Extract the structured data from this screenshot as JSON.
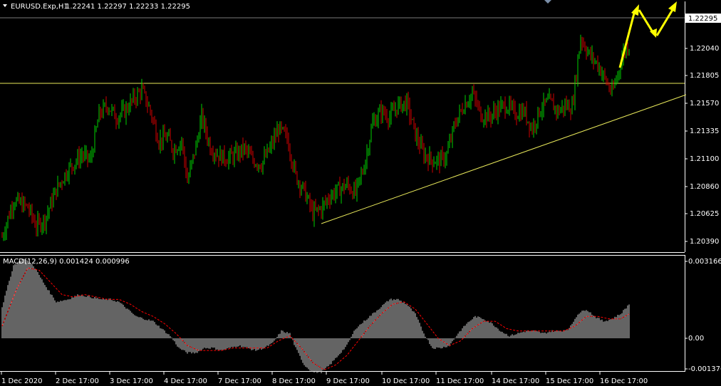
{
  "header": {
    "symbol_label": "EURUSD.Exp,H1",
    "ohlc_label": "1.22241 1.22297 1.22233 1.22295"
  },
  "macd_header": {
    "label": "MACD(12,26,9) 0.001424 0.000996"
  },
  "colors": {
    "background": "#000000",
    "bull": "#00d000",
    "bear": "#d00000",
    "line": "#e8e85a",
    "arrow": "#ffff00",
    "axis": "#ffffff",
    "macd_hist": "#c8c8c8",
    "macd_signal": "#ff0000"
  },
  "chart_data": [
    {
      "type": "candlestick",
      "title": "EURUSD.Exp,H1",
      "x_labels": [
        "1 Dec 2020",
        "2 Dec 17:00",
        "3 Dec 17:00",
        "4 Dec 17:00",
        "7 Dec 17:00",
        "8 Dec 17:00",
        "9 Dec 17:00",
        "10 Dec 17:00",
        "11 Dec 17:00",
        "14 Dec 17:00",
        "15 Dec 17:00",
        "16 Dec 17:00"
      ],
      "y_ticks": [
        "1.22295",
        "1.22040",
        "1.21805",
        "1.21570",
        "1.21335",
        "1.21100",
        "1.20860",
        "1.20625",
        "1.20390"
      ],
      "y_range": [
        1.2027,
        1.2263
      ],
      "current_price": 1.22295,
      "price_path": [
        [
          0,
          1.2043
        ],
        [
          8,
          1.2074
        ],
        [
          18,
          1.2068
        ],
        [
          24,
          1.2052
        ],
        [
          30,
          1.2058
        ],
        [
          38,
          1.2083
        ],
        [
          46,
          1.21
        ],
        [
          56,
          1.2113
        ],
        [
          62,
          1.2108
        ],
        [
          68,
          1.2147
        ],
        [
          74,
          1.2155
        ],
        [
          80,
          1.2145
        ],
        [
          86,
          1.215
        ],
        [
          92,
          1.216
        ],
        [
          98,
          1.2168
        ],
        [
          104,
          1.215
        ],
        [
          110,
          1.2125
        ],
        [
          116,
          1.2128
        ],
        [
          120,
          1.2117
        ],
        [
          126,
          1.2125
        ],
        [
          130,
          1.209
        ],
        [
          136,
          1.212
        ],
        [
          140,
          1.2145
        ],
        [
          146,
          1.212
        ],
        [
          152,
          1.2112
        ],
        [
          158,
          1.211
        ],
        [
          164,
          1.2113
        ],
        [
          170,
          1.2118
        ],
        [
          176,
          1.2108
        ],
        [
          182,
          1.2105
        ],
        [
          188,
          1.2118
        ],
        [
          194,
          1.2135
        ],
        [
          200,
          1.2127
        ],
        [
          206,
          1.2095
        ],
        [
          212,
          1.2082
        ],
        [
          218,
          1.2063
        ],
        [
          224,
          1.2067
        ],
        [
          230,
          1.2078
        ],
        [
          236,
          1.2083
        ],
        [
          242,
          1.2087
        ],
        [
          248,
          1.208
        ],
        [
          254,
          1.2103
        ],
        [
          260,
          1.214
        ],
        [
          266,
          1.215
        ],
        [
          272,
          1.2145
        ],
        [
          278,
          1.2155
        ],
        [
          284,
          1.2157
        ],
        [
          290,
          1.213
        ],
        [
          296,
          1.2113
        ],
        [
          302,
          1.2108
        ],
        [
          308,
          1.2108
        ],
        [
          312,
          1.2113
        ],
        [
          318,
          1.214
        ],
        [
          324,
          1.2155
        ],
        [
          330,
          1.2165
        ],
        [
          336,
          1.2147
        ],
        [
          342,
          1.2145
        ],
        [
          348,
          1.2152
        ],
        [
          354,
          1.2155
        ],
        [
          360,
          1.2148
        ],
        [
          366,
          1.215
        ],
        [
          372,
          1.2135
        ],
        [
          378,
          1.2153
        ],
        [
          384,
          1.2158
        ],
        [
          390,
          1.215
        ],
        [
          396,
          1.2155
        ],
        [
          400,
          1.2153
        ],
        [
          406,
          1.2213
        ],
        [
          412,
          1.2198
        ],
        [
          418,
          1.219
        ],
        [
          424,
          1.2175
        ],
        [
          428,
          1.2165
        ],
        [
          432,
          1.2182
        ],
        [
          436,
          1.22
        ],
        [
          440,
          1.2206
        ]
      ],
      "support_line": {
        "from": [
          1.2061,
          "9 Dec"
        ],
        "to": [
          1.2162,
          "16 Dec"
        ]
      },
      "resistance_level": 1.21755,
      "projected_arrows": "up, down, up (yellow)"
    },
    {
      "type": "histogram",
      "title": "MACD(12,26,9)",
      "values_label": [
        "0.001424",
        "0.000996"
      ],
      "y_ticks": [
        "0.003166",
        "0.00",
        "-0.001376"
      ],
      "y_range": [
        -0.00148,
        0.00324
      ],
      "macd_path": [
        [
          0,
          0.0013
        ],
        [
          8,
          0.003
        ],
        [
          15,
          0.0033
        ],
        [
          22,
          0.003
        ],
        [
          30,
          0.0022
        ],
        [
          38,
          0.0015
        ],
        [
          46,
          0.0016
        ],
        [
          54,
          0.0018
        ],
        [
          62,
          0.0017
        ],
        [
          70,
          0.0016
        ],
        [
          76,
          0.0016
        ],
        [
          82,
          0.0015
        ],
        [
          88,
          0.0012
        ],
        [
          94,
          0.0009
        ],
        [
          100,
          0.0008
        ],
        [
          106,
          0.0007
        ],
        [
          112,
          0.0004
        ],
        [
          118,
          0.0001
        ],
        [
          124,
          -0.0004
        ],
        [
          130,
          -0.0006
        ],
        [
          136,
          -0.0006
        ],
        [
          142,
          -0.0004
        ],
        [
          148,
          -0.0004
        ],
        [
          154,
          -0.0005
        ],
        [
          160,
          -0.0004
        ],
        [
          166,
          -0.0003
        ],
        [
          172,
          -0.0004
        ],
        [
          178,
          -0.0005
        ],
        [
          184,
          -0.0004
        ],
        [
          190,
          -0.0002
        ],
        [
          196,
          0.0003
        ],
        [
          202,
          0.0002
        ],
        [
          206,
          -0.0004
        ],
        [
          212,
          -0.0011
        ],
        [
          218,
          -0.0014
        ],
        [
          224,
          -0.0014
        ],
        [
          230,
          -0.0011
        ],
        [
          236,
          -0.0007
        ],
        [
          242,
          -0.0003
        ],
        [
          248,
          0.0004
        ],
        [
          254,
          0.0007
        ],
        [
          260,
          0.001
        ],
        [
          266,
          0.0013
        ],
        [
          272,
          0.0016
        ],
        [
          278,
          0.0016
        ],
        [
          284,
          0.0014
        ],
        [
          290,
          0.001
        ],
        [
          296,
          0.0002
        ],
        [
          302,
          -0.0004
        ],
        [
          308,
          -0.0004
        ],
        [
          314,
          -0.0003
        ],
        [
          320,
          0.0002
        ],
        [
          326,
          0.0006
        ],
        [
          332,
          0.0009
        ],
        [
          338,
          0.0008
        ],
        [
          344,
          0.0006
        ],
        [
          350,
          0.0003
        ],
        [
          356,
          0.0001
        ],
        [
          362,
          0.0002
        ],
        [
          368,
          0.0003
        ],
        [
          374,
          0.0003
        ],
        [
          380,
          0.0002
        ],
        [
          386,
          0.0003
        ],
        [
          392,
          0.0003
        ],
        [
          398,
          0.0004
        ],
        [
          404,
          0.001
        ],
        [
          410,
          0.0012
        ],
        [
          416,
          0.0009
        ],
        [
          422,
          0.0007
        ],
        [
          428,
          0.0008
        ],
        [
          434,
          0.001
        ],
        [
          440,
          0.0014
        ]
      ],
      "signal_path": [
        [
          0,
          0.0005
        ],
        [
          10,
          0.002
        ],
        [
          18,
          0.0029
        ],
        [
          26,
          0.0028
        ],
        [
          34,
          0.0023
        ],
        [
          42,
          0.0018
        ],
        [
          50,
          0.0017
        ],
        [
          58,
          0.0018
        ],
        [
          66,
          0.0017
        ],
        [
          74,
          0.0016
        ],
        [
          82,
          0.0016
        ],
        [
          90,
          0.0014
        ],
        [
          98,
          0.0011
        ],
        [
          106,
          0.0009
        ],
        [
          114,
          0.0006
        ],
        [
          122,
          0.0002
        ],
        [
          130,
          -0.0003
        ],
        [
          138,
          -0.0005
        ],
        [
          146,
          -0.0005
        ],
        [
          154,
          -0.0005
        ],
        [
          162,
          -0.0004
        ],
        [
          170,
          -0.0004
        ],
        [
          178,
          -0.0004
        ],
        [
          186,
          -0.0004
        ],
        [
          194,
          -0.0001
        ],
        [
          202,
          0.0001
        ],
        [
          210,
          -0.0004
        ],
        [
          218,
          -0.001
        ],
        [
          226,
          -0.0013
        ],
        [
          234,
          -0.0011
        ],
        [
          242,
          -0.0007
        ],
        [
          250,
          -0.0001
        ],
        [
          258,
          0.0005
        ],
        [
          266,
          0.001
        ],
        [
          274,
          0.0014
        ],
        [
          282,
          0.0015
        ],
        [
          290,
          0.0012
        ],
        [
          298,
          0.0006
        ],
        [
          306,
          0.0
        ],
        [
          314,
          -0.0003
        ],
        [
          322,
          -0.0001
        ],
        [
          330,
          0.0004
        ],
        [
          338,
          0.0007
        ],
        [
          346,
          0.0007
        ],
        [
          354,
          0.0004
        ],
        [
          362,
          0.0003
        ],
        [
          370,
          0.0003
        ],
        [
          378,
          0.0003
        ],
        [
          386,
          0.0003
        ],
        [
          394,
          0.0003
        ],
        [
          402,
          0.0005
        ],
        [
          410,
          0.0009
        ],
        [
          418,
          0.0009
        ],
        [
          426,
          0.0008
        ],
        [
          434,
          0.0008
        ],
        [
          440,
          0.001
        ]
      ]
    }
  ]
}
